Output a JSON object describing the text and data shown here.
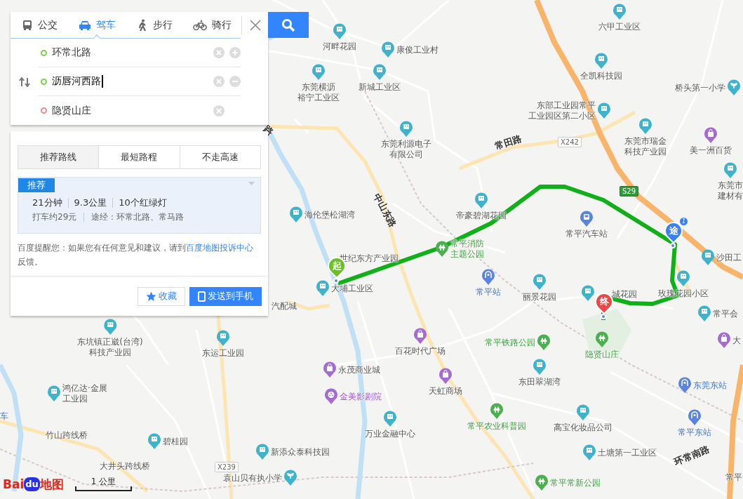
{
  "search_panel": {
    "modes": [
      {
        "kind": "bus",
        "label": "公交",
        "selected": false
      },
      {
        "kind": "car",
        "label": "驾车",
        "selected": true
      },
      {
        "kind": "walk",
        "label": "步行",
        "selected": false
      },
      {
        "kind": "bike",
        "label": "骑行",
        "selected": false
      }
    ],
    "stops": [
      {
        "kind": "origin",
        "value": "环常北路",
        "focused": false
      },
      {
        "kind": "waypoint",
        "value": "沥唇河西路",
        "focused": true
      },
      {
        "kind": "destination",
        "value": "隐贤山庄",
        "focused": false
      }
    ]
  },
  "route_panel": {
    "options": [
      {
        "label": "推荐路线",
        "selected": true
      },
      {
        "label": "最短路程",
        "selected": false
      },
      {
        "label": "不走高速",
        "selected": false
      }
    ],
    "result": {
      "badge": "推荐",
      "stats": [
        "21分钟",
        "9.3公里",
        "10个红绿灯"
      ],
      "taxi": "打车约29元",
      "via": "途经：环常北路、常马路"
    },
    "notice": {
      "before": "百度提醒您：如果您有任何意见和建议，请到",
      "link": "百度地图投诉中心",
      "after": "反馈。"
    },
    "buttons": [
      {
        "kind": "favorite",
        "label": "收藏"
      },
      {
        "kind": "send",
        "label": "发送到手机"
      }
    ]
  },
  "map": {
    "labels": [
      {
        "kind": "building",
        "lines": [
          "六甲工业区"
        ]
      },
      {
        "kind": "building",
        "lines": [
          "河畔花园"
        ]
      },
      {
        "kind": "building",
        "lines": [
          "康俊工业村"
        ]
      },
      {
        "kind": "building",
        "lines": [
          "东莞横沥",
          "裕宁工业区"
        ]
      },
      {
        "kind": "building",
        "lines": [
          "新城工业区"
        ]
      },
      {
        "kind": "building",
        "lines": [
          "东部工业园常平",
          "工业园区第二小区"
        ]
      },
      {
        "kind": "building",
        "lines": [
          "全凯科技园"
        ]
      },
      {
        "kind": "school",
        "lines": [
          "桥头第一小学"
        ]
      },
      {
        "kind": "building",
        "lines": [
          "东莞利源电子",
          "有限公司"
        ]
      },
      {
        "kind": "building",
        "lines": [
          "东莞市瑞金",
          "科技产业园"
        ]
      },
      {
        "kind": "shop",
        "lines": [
          "美一洲百货"
        ]
      },
      {
        "kind": "building",
        "lines": [
          "东莞市",
          "建材有"
        ]
      },
      {
        "kind": "building",
        "lines": [
          "帝豪碧湖花园"
        ]
      },
      {
        "kind": "bus",
        "lines": [
          "常平汽车站"
        ]
      },
      {
        "kind": "building",
        "lines": [
          "海伦堡松湖湾"
        ]
      },
      {
        "kind": "park",
        "lines": [
          "常平消防",
          "主题公园"
        ]
      },
      {
        "kind": "plain",
        "lines": [
          "世纪东方产业园"
        ]
      },
      {
        "kind": "building",
        "lines": [
          "大埔工业区"
        ]
      },
      {
        "kind": "station",
        "lines": [
          "常平站"
        ]
      },
      {
        "kind": "building",
        "lines": [
          "丽景花园"
        ]
      },
      {
        "kind": "building"
      },
      {
        "kind": "plain",
        "lines": [
          "城花园"
        ]
      },
      {
        "kind": "building",
        "lines": [
          "玫瑰花园小区"
        ]
      },
      {
        "kind": "building",
        "lines": [
          "沙田工"
        ]
      },
      {
        "kind": "building",
        "lines": [
          "常平会"
        ]
      },
      {
        "kind": "shop",
        "lines": [
          "大"
        ]
      },
      {
        "kind": "park",
        "lines": [
          "隐贤山庄"
        ]
      },
      {
        "kind": "park",
        "lines": [
          "常平铁路公园"
        ]
      },
      {
        "kind": "shop",
        "lines": [
          "百花时代广场"
        ]
      },
      {
        "kind": "building",
        "lines": [
          "东田翠湖湾"
        ]
      },
      {
        "kind": "shop",
        "lines": [
          "永茂商业城"
        ]
      },
      {
        "kind": "shop",
        "lines": [
          "天虹商场"
        ]
      },
      {
        "kind": "station",
        "lines": [
          "东莞东站"
        ]
      },
      {
        "kind": "cinema",
        "lines": [
          "金美影剧院"
        ]
      },
      {
        "kind": "building",
        "lines": [
          "万业金融中心"
        ]
      },
      {
        "kind": "park",
        "lines": [
          "常平农业科普园"
        ]
      },
      {
        "kind": "building",
        "lines": [
          "高宝化妆品公司"
        ]
      },
      {
        "kind": "station",
        "lines": [
          "常平东站"
        ]
      },
      {
        "kind": "building",
        "lines": [
          "土塘第一工业区"
        ]
      },
      {
        "kind": "park",
        "lines": [
          "常平常新公园"
        ]
      },
      {
        "kind": "building",
        "lines": [
          "东坑镇正崴(台湾)",
          "科技产业园"
        ]
      },
      {
        "kind": "building",
        "lines": [
          "东运工业园"
        ]
      },
      {
        "kind": "building",
        "lines": [
          "鸿亿达·金展",
          "工业园"
        ]
      },
      {
        "kind": "plain",
        "lines": [
          "竹山跨线桥"
        ]
      },
      {
        "kind": "building",
        "lines": [
          "碧桂园"
        ]
      },
      {
        "kind": "building",
        "lines": [
          "新添众泰科技园"
        ]
      },
      {
        "kind": "plain",
        "lines": [
          "大井头跨线桥"
        ]
      },
      {
        "kind": "school",
        "lines": [
          "袁山贝有执小学"
        ]
      },
      {
        "kind": "plain",
        "lines": [
          "汽配城"
        ]
      },
      {
        "kind": "station-text",
        "lines": [
          "车"
        ]
      },
      {
        "kind": "plain",
        "lines": [
          "常平"
        ]
      }
    ],
    "roads": [
      {
        "kind": "name",
        "label": "常田路"
      },
      {
        "kind": "name",
        "label": "中山东路"
      },
      {
        "kind": "shield",
        "label": "X242"
      },
      {
        "kind": "shield",
        "label": "S29"
      },
      {
        "kind": "shield",
        "label": "X239"
      },
      {
        "kind": "name",
        "label": "环常南路"
      },
      {
        "kind": "name",
        "label": "路"
      }
    ],
    "markers": [
      {
        "kind": "start",
        "label": "起"
      },
      {
        "kind": "end",
        "label": "终"
      },
      {
        "kind": "waypoint",
        "label": "途",
        "badge": "1"
      }
    ],
    "scale": "1 公里",
    "logo": [
      "Bai",
      "du",
      "地图"
    ]
  }
}
